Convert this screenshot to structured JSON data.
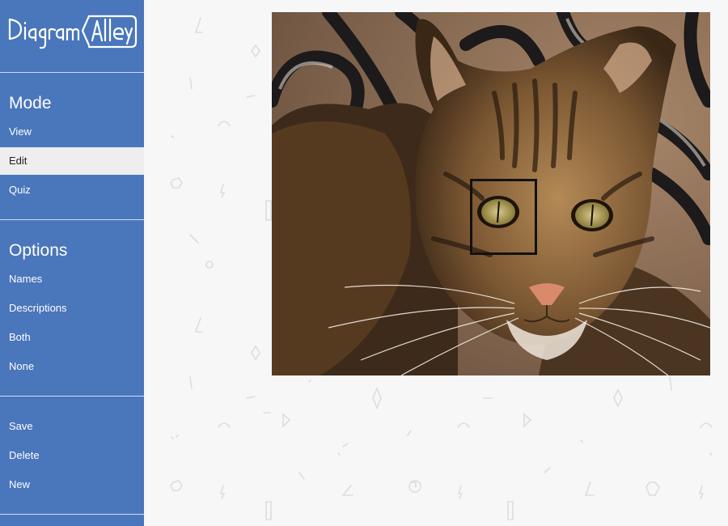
{
  "app": {
    "logo_text": "Diagram Alley"
  },
  "sidebar": {
    "mode": {
      "title": "Mode",
      "items": [
        {
          "label": "View",
          "active": false
        },
        {
          "label": "Edit",
          "active": true
        },
        {
          "label": "Quiz",
          "active": false
        }
      ]
    },
    "options": {
      "title": "Options",
      "items": [
        {
          "label": "Names"
        },
        {
          "label": "Descriptions"
        },
        {
          "label": "Both"
        },
        {
          "label": "None"
        }
      ]
    },
    "actions": {
      "items": [
        {
          "label": "Save"
        },
        {
          "label": "Delete"
        },
        {
          "label": "New"
        }
      ]
    }
  },
  "colors": {
    "sidebar_bg": "#4a76bb",
    "active_item_bg": "#eeeeef",
    "page_bg": "#f7f7f8",
    "selection_border": "#111111"
  },
  "canvas": {
    "image_subject": "tabby cat",
    "selection_tool": "rectangle"
  }
}
